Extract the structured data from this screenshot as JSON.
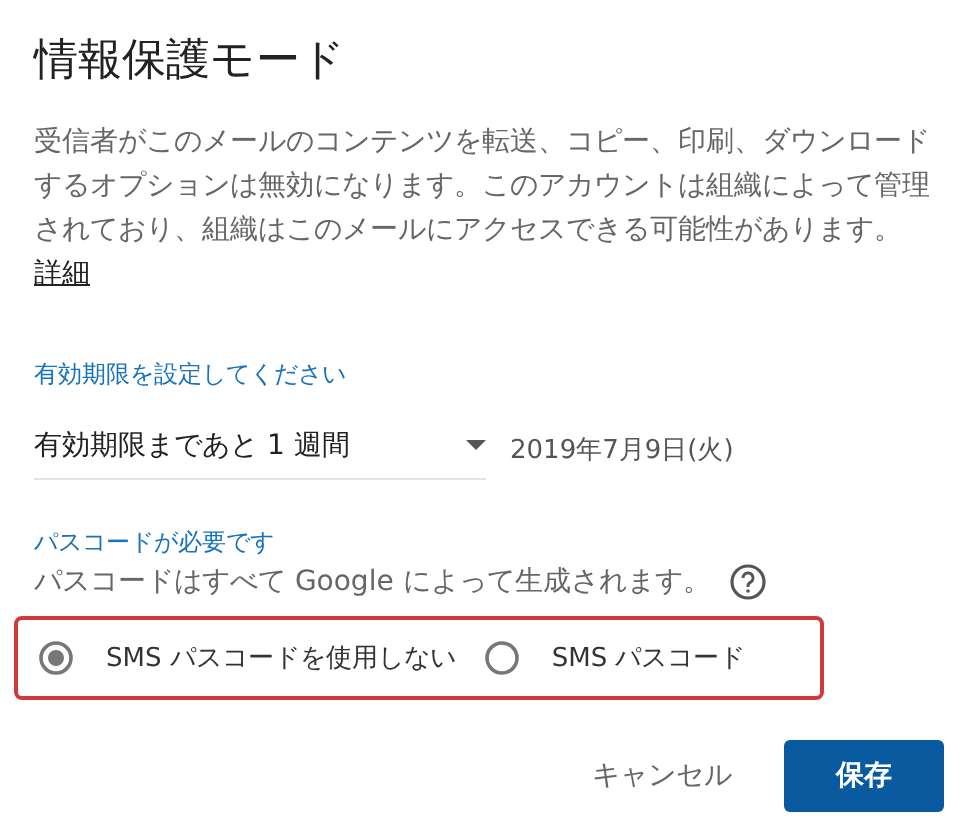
{
  "dialog": {
    "title": "情報保護モード",
    "description": "受信者がこのメールのコンテンツを転送、コピー、印刷、ダウンロードするオプションは無効になります。このアカウントは組織によって管理されており、組織はこのメールにアクセスできる可能性があります。",
    "details_link": "詳細"
  },
  "expiration": {
    "label": "有効期限を設定してください",
    "value": "有効期限まであと 1 週間",
    "date": "2019年7月9日(火)"
  },
  "passcode": {
    "label": "パスコードが必要です",
    "hint": "パスコードはすべて Google によって生成されます。",
    "options": [
      {
        "label": "SMS パスコードを使用しない",
        "selected": true
      },
      {
        "label": "SMS パスコード",
        "selected": false
      }
    ]
  },
  "buttons": [
    {
      "label": "キャンセル",
      "kind": "text"
    },
    {
      "label": "保存",
      "kind": "primary"
    }
  ]
}
